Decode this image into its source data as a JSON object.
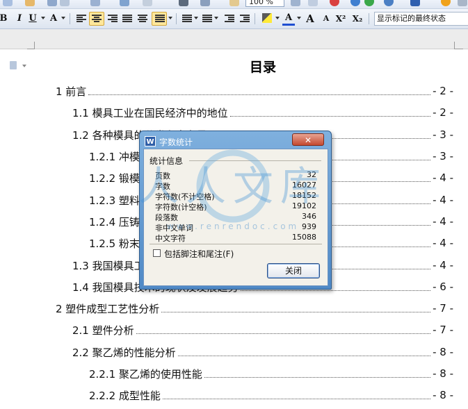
{
  "toolbar": {
    "zoom": "100 %",
    "display_state": "显示标记的最终状态",
    "bold": "B",
    "italic": "I",
    "underline": "U",
    "font_color_letter": "A",
    "grow_font": "A",
    "shrink_font": "A",
    "superscript": "X²",
    "subscript": "X₂"
  },
  "document": {
    "title": "目录",
    "toc": [
      {
        "label": "1 前言",
        "page": "- 2 -"
      },
      {
        "label": "1.1 模具工业在国民经济中的地位",
        "page": "- 2 -"
      },
      {
        "label": "1.2 各种模具的分类和占有量",
        "page": "- 3 -"
      },
      {
        "label": "1.2.1 冲模",
        "page": "- 3 -"
      },
      {
        "label": "1.2.2 锻模",
        "page": "- 4 -"
      },
      {
        "label": "1.2.3 塑料",
        "page": "- 4 -"
      },
      {
        "label": "1.2.4 压铸",
        "page": "- 4 -"
      },
      {
        "label": "1.2.5 粉末",
        "page": "- 4 -"
      },
      {
        "label": "1.3 我国模具工",
        "page": "- 4 -"
      },
      {
        "label": "1.4 我国模具技术的现状及发展趋势",
        "page": "- 6 -"
      },
      {
        "label": "2 塑件成型工艺性分析",
        "page": "- 7 -"
      },
      {
        "label": "2.1 塑件分析",
        "page": "- 7 -"
      },
      {
        "label": "2.2 聚乙烯的性能分析",
        "page": "- 8 -"
      },
      {
        "label": "2.2.1 聚乙烯的使用性能",
        "page": "- 8 -"
      },
      {
        "label": "2.2.2 成型性能",
        "page": "- 8 -"
      }
    ]
  },
  "watermark": {
    "text": "人人文库",
    "url": "www.renrendoc.com"
  },
  "dialog": {
    "title": "字数统计",
    "icon_letter": "W",
    "group_label": "统计信息",
    "stats": [
      {
        "label": "页数",
        "value": "32"
      },
      {
        "label": "字数",
        "value": "16027"
      },
      {
        "label": "字符数(不计空格)",
        "value": "18152"
      },
      {
        "label": "字符数(计空格)",
        "value": "19102"
      },
      {
        "label": "段落数",
        "value": "346"
      },
      {
        "label": "非中文单词",
        "value": "939"
      },
      {
        "label": "中文字符",
        "value": "15088"
      }
    ],
    "checkbox_label": "包括脚注和尾注(F)",
    "checkbox_checked": false,
    "close_button": "关闭",
    "close_x": "✕"
  }
}
